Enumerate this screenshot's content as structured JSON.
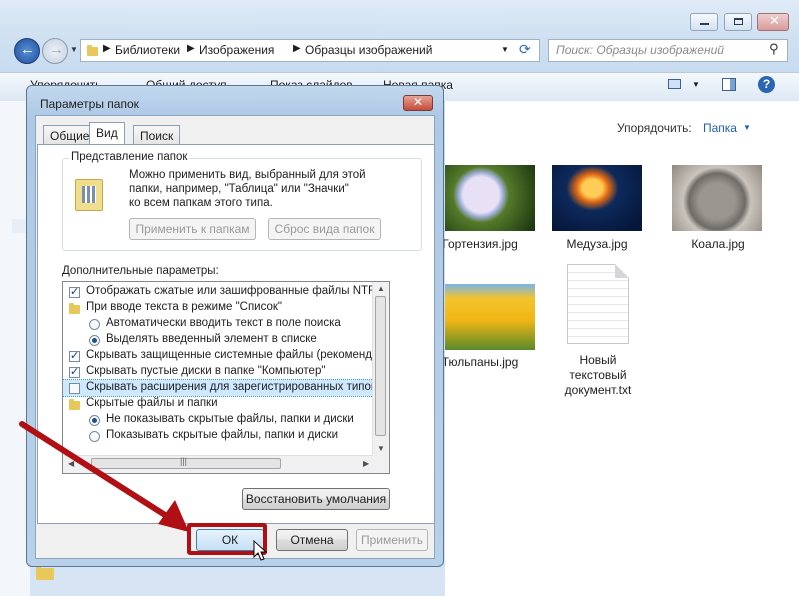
{
  "explorer": {
    "breadcrumb": [
      "Библиотеки",
      "Изображения",
      "Образцы изображений"
    ],
    "search_placeholder": "Поиск: Образцы изображений",
    "toolbar": {
      "organize": "Упорядочить",
      "share": "Общий доступ",
      "slideshow": "Показ слайдов",
      "new_folder": "Новая папка"
    },
    "arrange_label": "Упорядочить:",
    "arrange_value": "Папка",
    "files": [
      {
        "name": "Гортензия.jpg"
      },
      {
        "name": "Медуза.jpg"
      },
      {
        "name": "Коала.jpg"
      },
      {
        "name": "Тюльпаны.jpg"
      },
      {
        "name": "Новый текстовый документ.txt",
        "lines": [
          "Новый",
          "текстовый",
          "документ.txt"
        ]
      }
    ]
  },
  "dialog": {
    "title": "Параметры папок",
    "tabs": [
      "Общие",
      "Вид",
      "Поиск"
    ],
    "active_tab": "Вид",
    "group_title": "Представление папок",
    "group_text": [
      "Можно применить вид, выбранный для этой",
      "папки, например, \"Таблица\" или \"Значки\"",
      "ко всем папкам этого типа."
    ],
    "apply_to_folders": "Применить к папкам",
    "reset_folders": "Сброс вида папок",
    "advanced_label": "Дополнительные параметры:",
    "options": [
      {
        "type": "checkbox",
        "checked": true,
        "label": "Отображать сжатые или зашифрованные файлы NTFS д"
      },
      {
        "type": "folder",
        "label": "При вводе текста в режиме \"Список\""
      },
      {
        "type": "radio",
        "checked": false,
        "label": "Автоматически вводить текст в поле поиска"
      },
      {
        "type": "radio",
        "checked": true,
        "label": "Выделять введенный элемент в списке"
      },
      {
        "type": "checkbox",
        "checked": true,
        "label": "Скрывать защищенные системные файлы (рекоменду"
      },
      {
        "type": "checkbox",
        "checked": true,
        "label": "Скрывать пустые диски в папке \"Компьютер\""
      },
      {
        "type": "checkbox",
        "checked": false,
        "label": "Скрывать расширения для зарегистрированных типов ф",
        "selected": true
      },
      {
        "type": "folder",
        "label": "Скрытые файлы и папки"
      },
      {
        "type": "radio",
        "checked": true,
        "label": "Не показывать скрытые файлы, папки и диски"
      },
      {
        "type": "radio",
        "checked": false,
        "label": "Показывать скрытые файлы, папки и диски"
      }
    ],
    "restore_defaults": "Восстановить умолчания",
    "ok": "ОК",
    "cancel": "Отмена",
    "apply": "Применить"
  },
  "colors": {
    "highlight": "#b00f14",
    "selection": "#cde8ff",
    "link": "#1f5faf"
  }
}
